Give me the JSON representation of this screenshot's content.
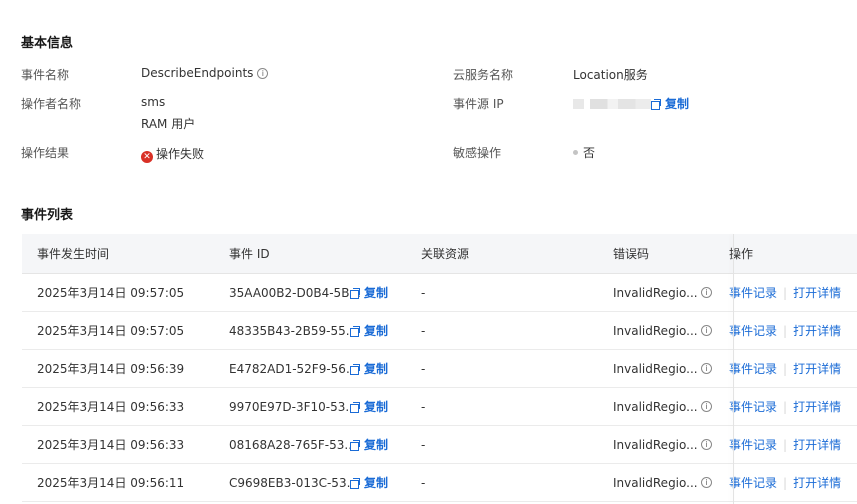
{
  "basic_info": {
    "title": "基本信息",
    "event_name_label": "事件名称",
    "event_name_value": "DescribeEndpoints",
    "cloud_service_label": "云服务名称",
    "cloud_service_value": "Location服务",
    "operator_label": "操作者名称",
    "operator_name": "sms",
    "operator_type": "RAM 用户",
    "source_ip_label": "事件源 IP",
    "copy_label": "复制",
    "result_label": "操作结果",
    "result_value": "操作失败",
    "sensitive_label": "敏感操作",
    "sensitive_value": "否"
  },
  "event_list": {
    "title": "事件列表",
    "columns": {
      "time": "事件发生时间",
      "event_id": "事件 ID",
      "resource": "关联资源",
      "error_code": "错误码",
      "actions": "操作"
    },
    "action_record": "事件记录",
    "action_detail": "打开详情",
    "copy_label": "复制",
    "rows": [
      {
        "time": "2025年3月14日 09:57:05",
        "event_id": "35AA00B2-D0B4-5B...",
        "resource": "-",
        "error_code": "InvalidRegio..."
      },
      {
        "time": "2025年3月14日 09:57:05",
        "event_id": "48335B43-2B59-55...",
        "resource": "-",
        "error_code": "InvalidRegio..."
      },
      {
        "time": "2025年3月14日 09:56:39",
        "event_id": "E4782AD1-52F9-56...",
        "resource": "-",
        "error_code": "InvalidRegio..."
      },
      {
        "time": "2025年3月14日 09:56:33",
        "event_id": "9970E97D-3F10-53...",
        "resource": "-",
        "error_code": "InvalidRegio..."
      },
      {
        "time": "2025年3月14日 09:56:33",
        "event_id": "08168A28-765F-53...",
        "resource": "-",
        "error_code": "InvalidRegio..."
      },
      {
        "time": "2025年3月14日 09:56:11",
        "event_id": "C9698EB3-013C-53...",
        "resource": "-",
        "error_code": "InvalidRegio..."
      }
    ]
  },
  "colors": {
    "link": "#1a6bd6",
    "error": "#d93026",
    "header_bg": "#f5f6f8"
  }
}
